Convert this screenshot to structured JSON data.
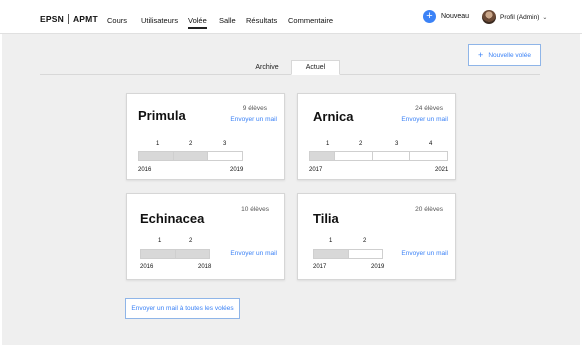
{
  "brand": {
    "left": "EPSN",
    "right": "APMT"
  },
  "nav": [
    {
      "label": "Cours",
      "active": false
    },
    {
      "label": "Utilisateurs",
      "active": false
    },
    {
      "label": "Volée",
      "active": true
    },
    {
      "label": "Salle",
      "active": false
    },
    {
      "label": "Résultats",
      "active": false
    },
    {
      "label": "Commentaire",
      "active": false
    }
  ],
  "header": {
    "nouveau_label": "Nouveau",
    "profile_label": "Profil (Admin)"
  },
  "tabs": {
    "archive": "Archive",
    "actuel": "Actuel"
  },
  "new_volee_label": "Nouvelle volée",
  "mail_all_label": "Envoyer un mail à toutes les volées",
  "colors": {
    "accent": "#3b82f6",
    "background": "#efefef",
    "progress_fill": "#d8d8d8"
  },
  "cards": [
    {
      "name": "Primula",
      "count": "9 élèves",
      "mail": "Envoyer un mail",
      "year_nums": [
        "1",
        "2",
        "3"
      ],
      "start": "2016",
      "end": "2019",
      "progress_years_done": 2
    },
    {
      "name": "Arnica",
      "count": "24 élèves",
      "mail": "Envoyer un mail",
      "year_nums": [
        "1",
        "2",
        "3",
        "4"
      ],
      "start": "2017",
      "end": "2021",
      "progress_years_done": 1
    },
    {
      "name": "Echinacea",
      "count": "10 élèves",
      "mail": "Envoyer un mail",
      "year_nums": [
        "1",
        "2"
      ],
      "start": "2016",
      "end": "2018",
      "progress_years_done": 2
    },
    {
      "name": "Tilia",
      "count": "20 élèves",
      "mail": "Envoyer un mail",
      "year_nums": [
        "1",
        "2"
      ],
      "start": "2017",
      "end": "2019",
      "progress_years_done": 1
    }
  ]
}
